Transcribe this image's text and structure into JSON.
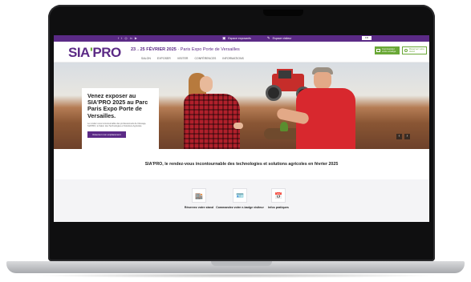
{
  "topbar": {
    "social_icons": [
      "facebook-icon",
      "twitter-icon",
      "instagram-icon",
      "linkedin-icon",
      "youtube-icon"
    ],
    "social_glyphs": [
      "f",
      "t",
      "◎",
      "in",
      "▶"
    ],
    "links": [
      {
        "icon": "badge-icon",
        "glyph": "▣",
        "label": "Espace exposants"
      },
      {
        "icon": "pencil-icon",
        "glyph": "✎",
        "label": "Espace visiteur"
      }
    ],
    "language": "FR"
  },
  "header": {
    "logo_main": "SIA",
    "logo_accent": "'",
    "logo_end": "PRO",
    "dates": "23→25 FÉVRIER 2025",
    "venue": "· Paris Expo Porte de Versailles",
    "nav": [
      "Salon",
      "Exposer",
      "Visiter",
      "Conférences",
      "Informations"
    ],
    "cta_primary": "Commandez votre e-badge",
    "cta_secondary": "Réservez votre stand"
  },
  "hero": {
    "title": "Venez exposer au SIA'PRO 2025 au Parc Paris Expo Porte de Versailles.",
    "text": "Le rendez-vous incontournable des professionnels de l'élevage, SIA'PRO, le Salon des Technologies et Solutions Agricoles.",
    "button": "Réserver mon emplacement",
    "prev": "‹",
    "next": "›"
  },
  "tagline": "SIA'PRO, le rendez-vous incontournable des technologies et solutions agricoles en février 2025",
  "quicklinks": [
    {
      "icon": "storefront-icon",
      "glyph": "🏬",
      "label": "Réservez votre stand"
    },
    {
      "icon": "id-badge-icon",
      "glyph": "🪪",
      "label": "Commandez votre e-badge visiteur"
    },
    {
      "icon": "calendar-icon",
      "glyph": "📅",
      "label": "Infos pratiques"
    }
  ],
  "colors": {
    "brand_purple": "#5b2a86",
    "brand_green": "#6aa837"
  }
}
